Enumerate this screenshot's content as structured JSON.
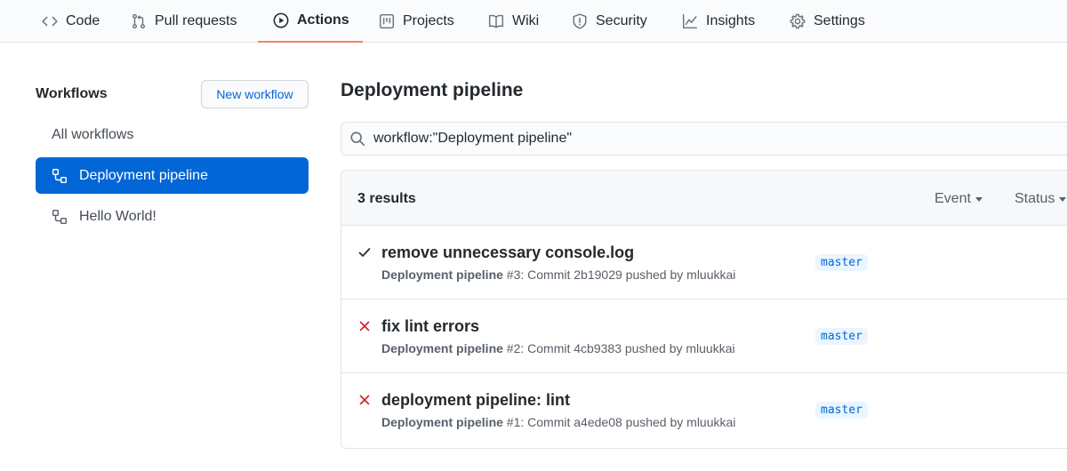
{
  "nav": {
    "tabs": [
      {
        "label": "Code",
        "icon": "code-icon"
      },
      {
        "label": "Pull requests",
        "icon": "pull-request-icon"
      },
      {
        "label": "Actions",
        "icon": "play-icon",
        "active": true
      },
      {
        "label": "Projects",
        "icon": "project-icon"
      },
      {
        "label": "Wiki",
        "icon": "book-icon"
      },
      {
        "label": "Security",
        "icon": "shield-icon"
      },
      {
        "label": "Insights",
        "icon": "graph-icon"
      },
      {
        "label": "Settings",
        "icon": "gear-icon"
      }
    ]
  },
  "sidebar": {
    "title": "Workflows",
    "new_button": "New workflow",
    "items": [
      {
        "label": "All workflows"
      },
      {
        "label": "Deployment pipeline",
        "icon": "workflow-icon",
        "selected": true
      },
      {
        "label": "Hello World!",
        "icon": "workflow-icon"
      }
    ]
  },
  "main": {
    "title": "Deployment pipeline",
    "search_value": "workflow:\"Deployment pipeline\"",
    "results_label": "3 results",
    "filters": {
      "event": "Event",
      "status": "Status"
    },
    "runs": [
      {
        "title": "remove unnecessary console.log",
        "workflow": "Deployment pipeline",
        "details": " #3: Commit 2b19029 pushed by mluukkai",
        "branch": "master",
        "status": "success"
      },
      {
        "title": "fix lint errors",
        "workflow": "Deployment pipeline",
        "details": " #2: Commit 4cb9383 pushed by mluukkai",
        "branch": "master",
        "status": "failure"
      },
      {
        "title": "deployment pipeline: lint",
        "workflow": "Deployment pipeline",
        "details": " #1: Commit a4ede08 pushed by mluukkai",
        "branch": "master",
        "status": "failure"
      }
    ]
  },
  "colors": {
    "accent": "#0366d6",
    "active_tab_underline": "#f9826c",
    "success": "#24292e",
    "failure": "#cb2431"
  }
}
